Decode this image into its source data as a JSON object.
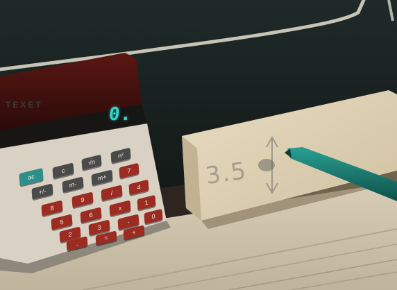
{
  "calculator": {
    "display": "0.",
    "brand": "TEXET",
    "keys": [
      {
        "label": "ac",
        "name": "key-ac",
        "tone": "teal"
      },
      {
        "label": "c",
        "name": "key-c",
        "tone": "grey"
      },
      {
        "label": "√n",
        "name": "key-sqrt",
        "tone": "grey"
      },
      {
        "label": "n²",
        "name": "key-square",
        "tone": "grey"
      },
      {
        "label": "+/-",
        "name": "key-plus-minus",
        "tone": "grey"
      },
      {
        "label": "m-",
        "name": "key-memory-minus",
        "tone": "grey"
      },
      {
        "label": "m+",
        "name": "key-memory-plus",
        "tone": "grey"
      },
      {
        "label": "7",
        "name": "key-7",
        "tone": "red"
      },
      {
        "label": "8",
        "name": "key-8",
        "tone": "red"
      },
      {
        "label": "9",
        "name": "key-9",
        "tone": "red"
      },
      {
        "label": "/",
        "name": "key-divide",
        "tone": "red"
      },
      {
        "label": "4",
        "name": "key-4",
        "tone": "red"
      },
      {
        "label": "5",
        "name": "key-5",
        "tone": "red"
      },
      {
        "label": "6",
        "name": "key-6",
        "tone": "red"
      },
      {
        "label": "x",
        "name": "key-multiply",
        "tone": "red"
      },
      {
        "label": "1",
        "name": "key-1",
        "tone": "red"
      },
      {
        "label": "2",
        "name": "key-2",
        "tone": "red"
      },
      {
        "label": "3",
        "name": "key-3",
        "tone": "red"
      },
      {
        "label": "-",
        "name": "key-minus",
        "tone": "red"
      },
      {
        "label": "0",
        "name": "key-0",
        "tone": "red"
      },
      {
        "label": ".",
        "name": "key-decimal",
        "tone": "red"
      },
      {
        "label": "=",
        "name": "key-equals",
        "tone": "red"
      },
      {
        "label": "+",
        "name": "key-plus",
        "tone": "red"
      }
    ]
  },
  "block": {
    "note": "3.5"
  },
  "colors": {
    "chalkboard": "#1b2523",
    "chalk": "#d9d6c8",
    "wood": "#dccfb4",
    "calculator_body": "#d8d1c4",
    "calculator_top": "#4a1210",
    "pen": "#19685f"
  }
}
